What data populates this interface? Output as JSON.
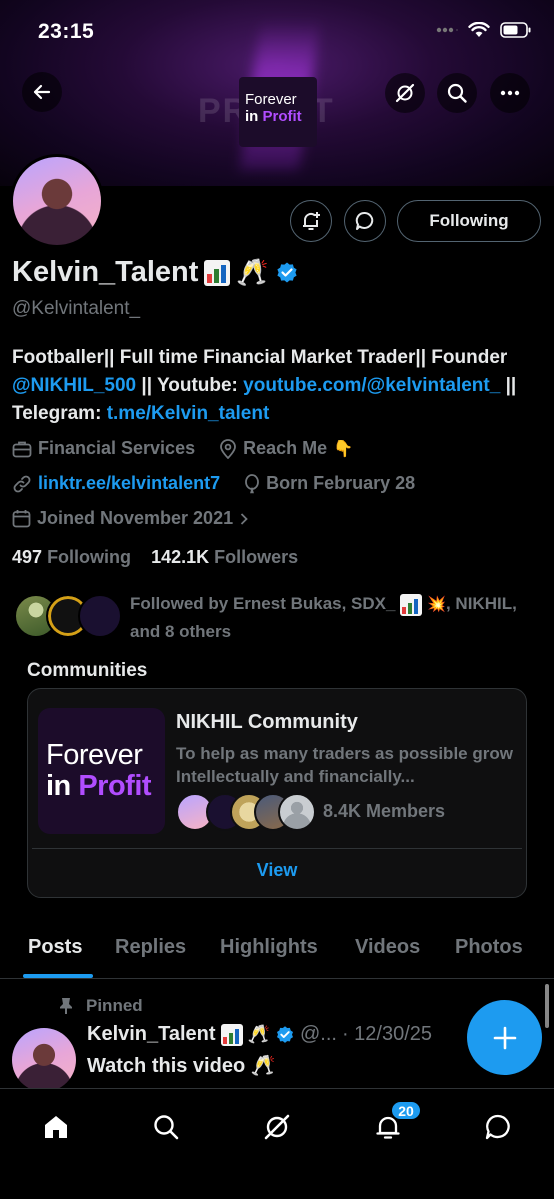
{
  "status_bar": {
    "time": "23:15"
  },
  "banner": {
    "big_text": "PROFIT",
    "logo_line1": "Forever",
    "logo_line2_a": "in",
    "logo_line2_b": "Profit"
  },
  "profile": {
    "name": "Kelvin_Talent",
    "name_emoji": "🥂",
    "handle": "@Kelvintalent_",
    "follow_button": "Following",
    "bio": {
      "t1": "Footballer|| Full time Financial Market Trader|| Founder ",
      "mention": "@NIKHIL_500",
      "t2": " || Youtube: ",
      "youtube": "youtube.com/@kelvintalent_",
      "t3": " || Telegram: ",
      "telegram": "t.me/Kelvin_talent"
    },
    "category": "Financial Services",
    "location": "Reach Me",
    "location_emoji": "👇",
    "website": "linktr.ee/kelvintalent7",
    "born": "Born February 28",
    "joined": "Joined November 2021",
    "following_count": "497",
    "following_label": "Following",
    "followers_count": "142.1K",
    "followers_label": "Followers",
    "followed_by_a": "Followed by Ernest Bukas, SDX_",
    "followed_by_emoji": "💥",
    "followed_by_b": ", NIKHIL, and 8 others"
  },
  "communities": {
    "label": "Communities",
    "card": {
      "logo_line1": "Forever",
      "logo_line2_a": "in",
      "logo_line2_b": "Profit",
      "name": "NIKHIL Community",
      "description": "To help as many traders as possible grow Intellectually and financially...",
      "members": "8.4K Members",
      "view_label": "View"
    }
  },
  "tabs": [
    "Posts",
    "Replies",
    "Highlights",
    "Videos",
    "Photos"
  ],
  "post": {
    "pinned_label": "Pinned",
    "author": "Kelvin_Talent",
    "author_emoji": "🥂",
    "handle": "@...",
    "date": "· 12/30/25",
    "text": "Watch this video 🥂"
  },
  "bottom_nav": {
    "notifications_badge": "20"
  },
  "colors": {
    "accent": "#1d9bf0",
    "background": "#000000",
    "muted_text": "#71767b",
    "brand_purple": "#b14dff"
  }
}
